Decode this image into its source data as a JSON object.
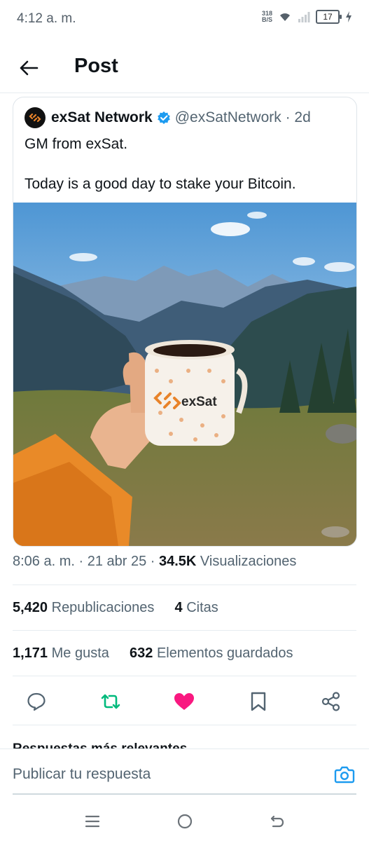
{
  "status_bar": {
    "time": "4:12 a. m.",
    "net_speed_value": "318",
    "net_speed_unit": "B/S",
    "battery": "17"
  },
  "header": {
    "title": "Post"
  },
  "quote": {
    "author_name": "exSat Network",
    "handle_time": "@exSatNetwork · 2d",
    "line1": "GM from exSat.",
    "line2": "Today is a good day to stake your Bitcoin.",
    "mug_brand": "exSat"
  },
  "meta": {
    "datetime": "8:06 a. m. · 21 abr 25 · ",
    "views_count": "34.5K",
    "views_label": " Visualizaciones"
  },
  "stats": {
    "reposts_count": "5,420",
    "reposts_label": " Republicaciones",
    "quotes_count": "4",
    "quotes_label": " Citas",
    "likes_count": "1,171",
    "likes_label": " Me gusta",
    "bookmarks_count": "632",
    "bookmarks_label": " Elementos guardados"
  },
  "replies_heading": "Respuestas más relevantes",
  "reply": {
    "placeholder": "Publicar tu respuesta"
  },
  "colors": {
    "accent": "#1d9bf0",
    "repost_active": "#00ba7c",
    "like_active": "#f91880",
    "brand_orange": "#e8832a"
  },
  "icons": {
    "back": "arrow-left-icon",
    "verified": "verified-badge-icon",
    "reply": "comment-icon",
    "repost": "repost-icon",
    "like": "heart-icon",
    "bookmark": "bookmark-icon",
    "share": "share-icon",
    "camera": "camera-icon"
  }
}
